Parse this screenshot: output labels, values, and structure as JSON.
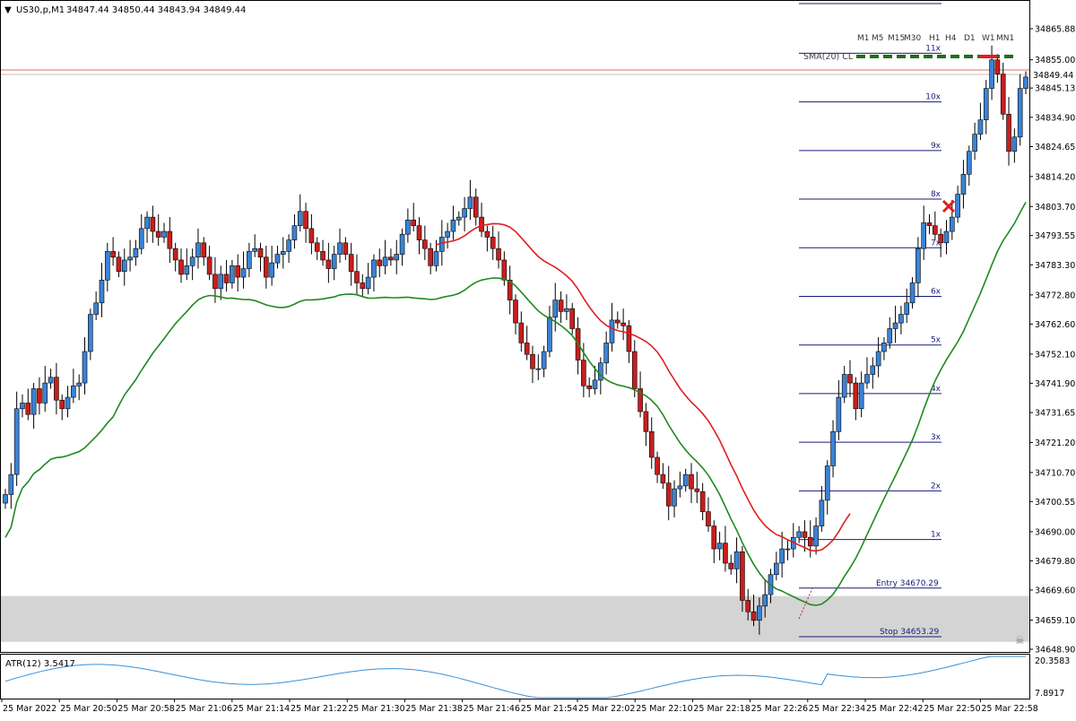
{
  "header": {
    "collapse_glyph": "▼",
    "symbol_label": "US30,p,M1",
    "ohlc": "34847.44 34850.44 34843.94 34849.44"
  },
  "timeframes": [
    "M1",
    "M5",
    "M15",
    "M30",
    "H1",
    "H4",
    "D1",
    "W1",
    "MN1"
  ],
  "indicator_label": "SMA(20) CL",
  "current_price_label": "34849.44",
  "atr": {
    "label": "ATR(12) 3.5417",
    "scale_top": "20.3583",
    "scale_bottom": "7.8917"
  },
  "levels": {
    "entry_label": "Entry",
    "entry_value": "34670.29",
    "stop_label": "Stop",
    "stop_value": "34653.29",
    "multiples": [
      "1x",
      "2x",
      "3x",
      "4x",
      "5x",
      "6x",
      "7x",
      "8x",
      "9x",
      "10x",
      "11x"
    ]
  },
  "time_labels": [
    "25 Mar 2022",
    "25 Mar 20:50",
    "25 Mar 20:58",
    "25 Mar 21:06",
    "25 Mar 21:14",
    "25 Mar 21:22",
    "25 Mar 21:30",
    "25 Mar 21:38",
    "25 Mar 21:46",
    "25 Mar 21:54",
    "25 Mar 22:02",
    "25 Mar 22:10",
    "25 Mar 22:18",
    "25 Mar 22:26",
    "25 Mar 22:34",
    "25 Mar 22:42",
    "25 Mar 22:50",
    "25 Mar 22:58"
  ],
  "price_labels": [
    "34865.88",
    "34855.00",
    "34845.13",
    "34834.90",
    "34824.65",
    "34814.20",
    "34803.70",
    "34793.55",
    "34783.30",
    "34772.80",
    "34762.60",
    "34752.10",
    "34741.90",
    "34731.65",
    "34721.20",
    "34710.70",
    "34700.55",
    "34690.00",
    "34679.80",
    "34669.60",
    "34659.10",
    "34648.90"
  ],
  "colors": {
    "bull": "#3a83d6",
    "bear": "#c81e1e",
    "sma_up": "#1e8a1e",
    "sma_down": "#e01e1e",
    "level_line": "#1a1a78",
    "stop_zone": "#d4d4d4",
    "price_line": "#e07050",
    "atr_line": "#3a8fd8"
  },
  "chart_data": {
    "type": "candlestick",
    "timeframe": "M1",
    "x": [
      "20:41",
      "20:42",
      "20:43",
      "20:44",
      "20:45",
      "20:46",
      "20:47",
      "20:48",
      "20:49",
      "20:50",
      "20:51",
      "20:52",
      "20:53",
      "20:54",
      "20:55",
      "20:56",
      "20:57",
      "20:58",
      "20:59",
      "21:00",
      "21:01",
      "21:02",
      "21:03",
      "21:04",
      "21:05",
      "21:06",
      "21:07",
      "21:08",
      "21:09",
      "21:10",
      "21:11",
      "21:12",
      "21:13",
      "21:14",
      "21:15",
      "21:16",
      "21:17",
      "21:18",
      "21:19",
      "21:20",
      "21:21",
      "21:22",
      "21:23",
      "21:24",
      "21:25",
      "21:26",
      "21:27",
      "21:28",
      "21:29",
      "21:30",
      "21:31",
      "21:32",
      "21:33",
      "21:34",
      "21:35",
      "21:36",
      "21:37",
      "21:38",
      "21:39",
      "21:40",
      "21:41",
      "21:42",
      "21:43",
      "21:44",
      "21:45",
      "21:46",
      "21:47",
      "21:48",
      "21:49",
      "21:50",
      "21:51",
      "21:52",
      "21:53",
      "21:54",
      "21:55",
      "21:56",
      "21:57",
      "21:58",
      "21:59",
      "22:00",
      "22:01",
      "22:02",
      "22:03",
      "22:04",
      "22:05",
      "22:06",
      "22:07",
      "22:08",
      "22:09",
      "22:10",
      "22:11",
      "22:12",
      "22:13",
      "22:14",
      "22:15",
      "22:16",
      "22:17",
      "22:18",
      "22:19",
      "22:20",
      "22:21",
      "22:22",
      "22:23",
      "22:24",
      "22:25",
      "22:26",
      "22:27",
      "22:28",
      "22:29",
      "22:30",
      "22:31",
      "22:32",
      "22:33",
      "22:34",
      "22:35",
      "22:36",
      "22:37",
      "22:38",
      "22:39",
      "22:40",
      "22:41",
      "22:42",
      "22:43",
      "22:44",
      "22:45",
      "22:46",
      "22:47",
      "22:48",
      "22:49",
      "22:50",
      "22:51",
      "22:52",
      "22:53",
      "22:54",
      "22:55",
      "22:56",
      "22:57",
      "22:58",
      "22:59"
    ],
    "close": [
      34703,
      34710,
      34733,
      34735,
      34731,
      34740,
      34735,
      34742,
      34744,
      34736,
      34733,
      34737,
      34741,
      34742,
      34753,
      34766,
      34770,
      34778,
      34788,
      34786,
      34781,
      34785,
      34786,
      34789,
      34796,
      34800,
      34795,
      34793,
      34795,
      34789,
      34785,
      34780,
      34783,
      34786,
      34791,
      34786,
      34780,
      34775,
      34780,
      34777,
      34783,
      34779,
      34782,
      34788,
      34789,
      34786,
      34779,
      34784,
      34787,
      34788,
      34792,
      34797,
      34802,
      34796,
      34791,
      34788,
      34785,
      34782,
      34787,
      34791,
      34787,
      34781,
      34777,
      34775,
      34779,
      34785,
      34783,
      34786,
      34785,
      34787,
      34794,
      34799,
      34797,
      34792,
      34789,
      34783,
      34788,
      34793,
      34795,
      34799,
      34800,
      34803,
      34807,
      34800,
      34795,
      34793,
      34789,
      34785,
      34778,
      34771,
      34763,
      34756,
      34752,
      34747,
      34747,
      34753,
      34765,
      34771,
      34767,
      34768,
      34761,
      34750,
      34741,
      34740,
      34743,
      34749,
      34756,
      34764,
      34763,
      34762,
      34753,
      34740,
      34732,
      34725,
      34716,
      34710,
      34707,
      34699,
      34705,
      34706,
      34710,
      34705,
      34704,
      34697,
      34692,
      34684,
      34686,
      34679,
      34677,
      34683,
      34666,
      34662,
      34659,
      34664,
      34668,
      34675,
      34679,
      34684,
      34684,
      34688,
      34690,
      34688,
      34685,
      34692,
      34701,
      34713,
      34725,
      34737,
      34745,
      34742,
      34733,
      34742,
      34745,
      34748,
      34753,
      34756,
      34761,
      34763,
      34766,
      34770,
      34777,
      34789,
      34798,
      34797,
      34794,
      34791,
      34795,
      34800,
      34808,
      34815,
      34823,
      34829,
      34834,
      34845,
      34855,
      34850,
      34836,
      34823,
      34828,
      34845,
      34849
    ],
    "note": "close price per 1-minute bar",
    "ylim": [
      34648.9,
      34865.88
    ],
    "indicators": [
      "SMA(20) CL",
      "ATR(12)"
    ]
  }
}
